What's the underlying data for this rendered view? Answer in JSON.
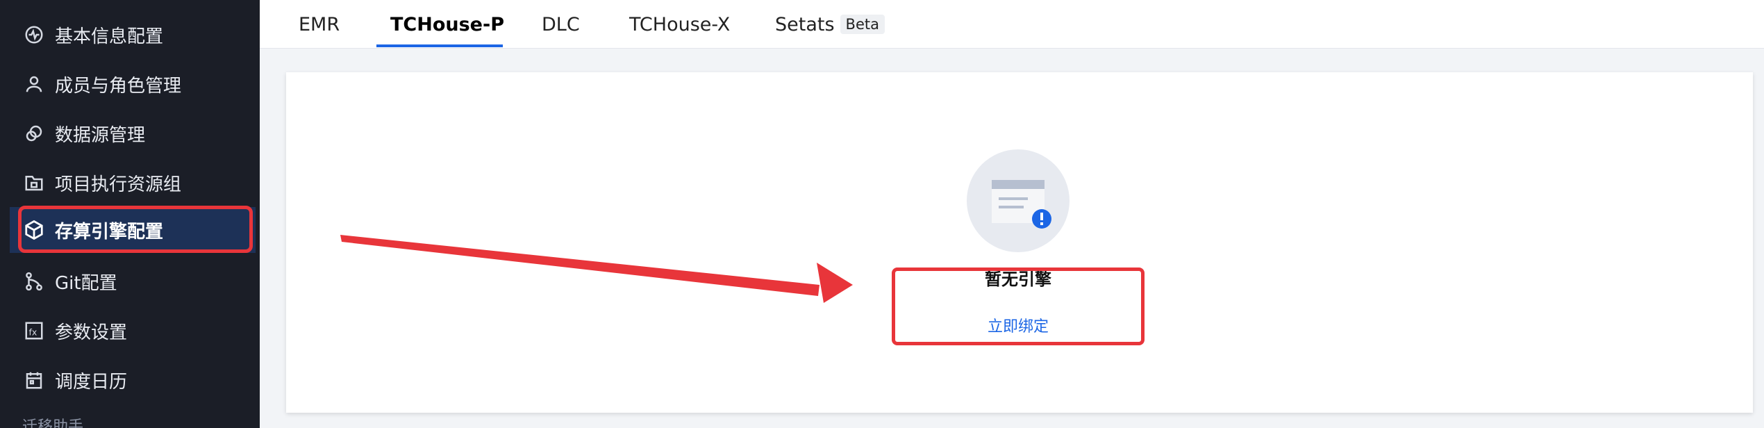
{
  "sidebar": {
    "items": [
      {
        "label": "基本信息配置",
        "icon": "activity-icon"
      },
      {
        "label": "成员与角色管理",
        "icon": "user-icon"
      },
      {
        "label": "数据源管理",
        "icon": "datasource-icon"
      },
      {
        "label": "项目执行资源组",
        "icon": "folder-icon"
      },
      {
        "label": "存算引擎配置",
        "icon": "cube-icon",
        "active": true
      },
      {
        "label": "Git配置",
        "icon": "git-branch-icon"
      },
      {
        "label": "参数设置",
        "icon": "fx-icon"
      },
      {
        "label": "调度日历",
        "icon": "calendar-icon"
      }
    ],
    "footer_partial": "迁移助手"
  },
  "tabs": {
    "items": [
      {
        "label": "EMR"
      },
      {
        "label": "TCHouse-P",
        "active": true
      },
      {
        "label": "DLC"
      },
      {
        "label": "TCHouse-X"
      },
      {
        "label": "Setats",
        "badge": "Beta"
      }
    ]
  },
  "empty_state": {
    "icon": "empty-document-alert-icon",
    "title": "暂无引擎",
    "action_label": "立即绑定"
  },
  "colors": {
    "sidebar_bg": "#1b1e27",
    "active_item_bg": "#1d3157",
    "highlight_red": "#e8353a",
    "link_blue": "#1c66e5"
  }
}
